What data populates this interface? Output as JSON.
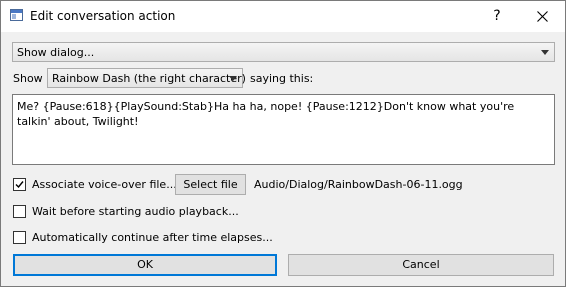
{
  "window": {
    "title": "Edit conversation action",
    "help_glyph": "?",
    "close_icon": "close-icon"
  },
  "action_select": {
    "value": "Show dialog..."
  },
  "dialog_row": {
    "show_label": "Show",
    "character_value": "Rainbow Dash (the right character)",
    "saying_label": "saying this:"
  },
  "dialog_text": "Me? {Pause:618}{PlaySound:Stab}Ha ha ha, nope! {Pause:1212}Don't know what you're talkin' about, Twilight!",
  "voice_over": {
    "checked": true,
    "label": "Associate voice-over file...",
    "select_button": "Select file",
    "file_path": "Audio/Dialog/RainbowDash-06-11.ogg"
  },
  "wait_option": {
    "checked": false,
    "label": "Wait before starting audio playback..."
  },
  "auto_continue_option": {
    "checked": false,
    "label": "Automatically continue after time elapses..."
  },
  "buttons": {
    "ok": "OK",
    "cancel": "Cancel"
  },
  "colors": {
    "focus_border": "#0078d7",
    "window_bg": "#f0f0f0"
  }
}
